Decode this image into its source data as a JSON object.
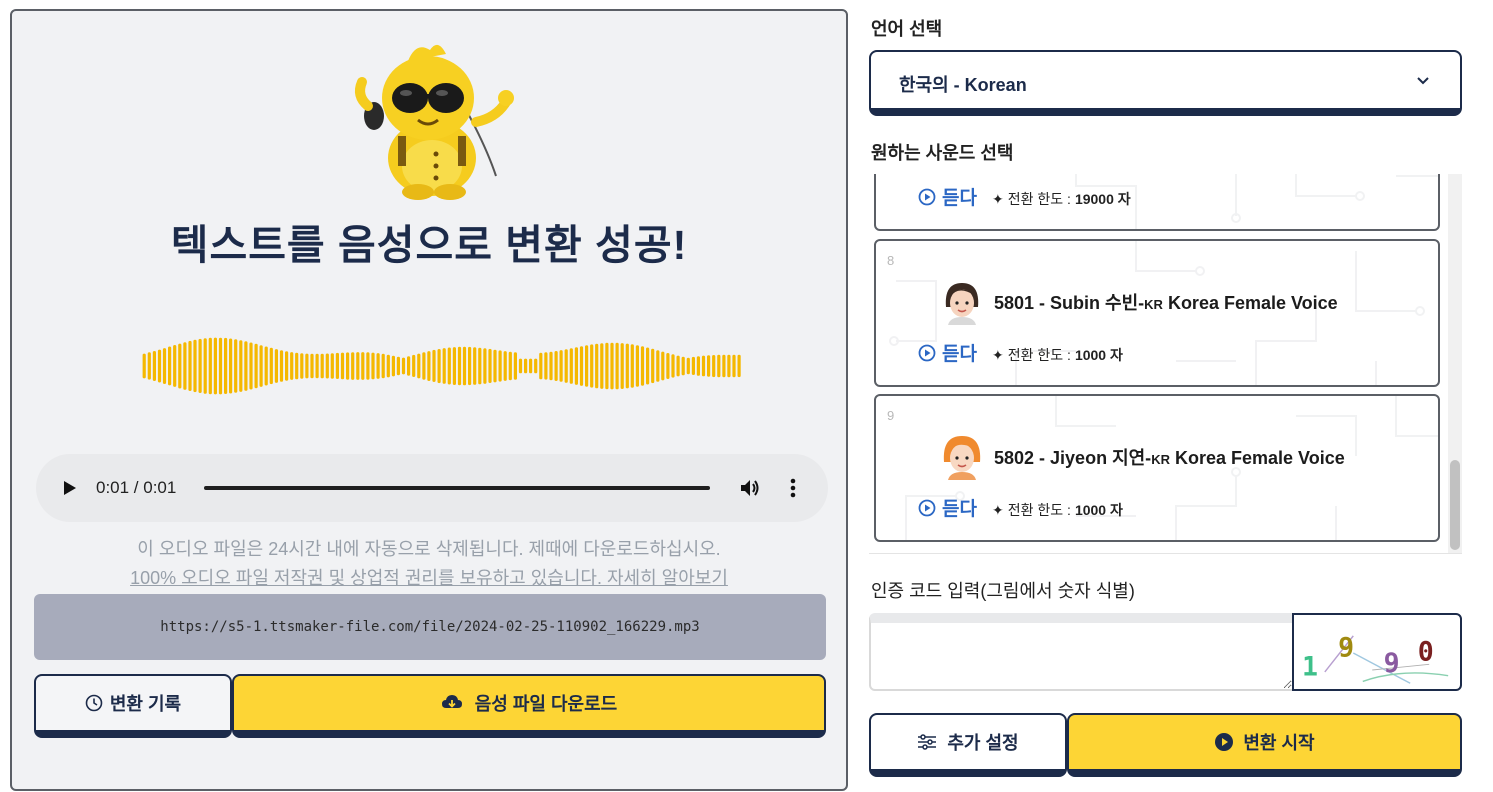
{
  "result": {
    "title": "텍스트를 음성으로 변환 성공!",
    "player": {
      "time": "0:01 / 0:01"
    },
    "notice_line1": "이 오디오 파일은 24시간 내에 자동으로 삭제됩니다. 제때에 다운로드하십시오.",
    "notice_link": "100% 오디오 파일 저작권 및 상업적 권리를 보유하고 있습니다. 자세히 알아보기",
    "url": "https://s5-1.ttsmaker-file.com/file/2024-02-25-110902_166229.mp3",
    "history_label": "변환 기록",
    "download_label": "음성 파일 다운로드"
  },
  "language": {
    "label": "언어 선택",
    "selected": "한국의 - Korean"
  },
  "voices": {
    "label": "원하는 사운드 선택",
    "listen_label": "듣다",
    "limit_prefix": "전환 한도 :",
    "items": [
      {
        "number": "",
        "name": "",
        "limit": "19000 자"
      },
      {
        "number": "8",
        "name": "5801 - Subin 수빈-",
        "tag": "KR",
        "suffix": " Korea Female Voice",
        "limit": "1000 자"
      },
      {
        "number": "9",
        "name": "5802 - Jiyeon 지연-",
        "tag": "KR",
        "suffix": " Korea Female Voice",
        "limit": "1000 자"
      }
    ]
  },
  "captcha": {
    "label": "인증 코드 입력(그림에서 숫자 식별)",
    "value": "",
    "digits": [
      "1",
      "9",
      "9",
      "0"
    ]
  },
  "actions": {
    "advanced_label": "추가 설정",
    "start_label": "변환 시작"
  },
  "colors": {
    "accent": "#fdd535",
    "navy": "#1c2b4a",
    "wave": "#f5b800",
    "link": "#2b67c4"
  }
}
